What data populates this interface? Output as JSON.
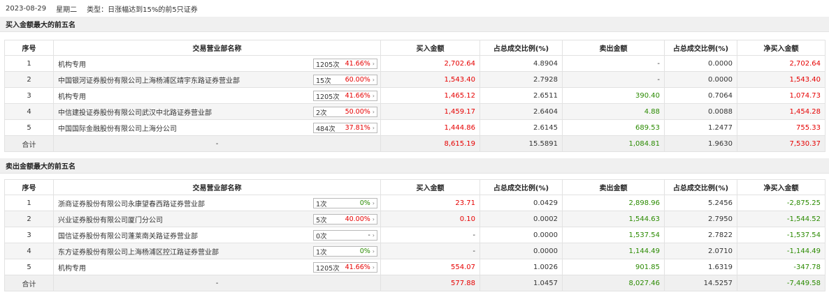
{
  "header": {
    "date": "2023-08-29",
    "weekday": "星期二",
    "type_label": "类型：日涨幅达到15%的前5只证券"
  },
  "buy": {
    "title": "买入金额最大的前五名",
    "columns": [
      "序号",
      "交易营业部名称",
      "买入金额",
      "占总成交比例(%)",
      "卖出金额",
      "占总成交比例(%)",
      "净买入金额"
    ],
    "rows": [
      {
        "no": "1",
        "name": "机构专用",
        "count": "1205次",
        "pct": "41.66%",
        "buy": "2,702.64",
        "buy_ratio": "4.8904",
        "sell": "-",
        "sell_ratio": "0.0000",
        "net": "2,702.64"
      },
      {
        "no": "2",
        "name": "中国银河证券股份有限公司上海杨浦区靖宇东路证券营业部",
        "count": "15次",
        "pct": "60.00%",
        "buy": "1,543.40",
        "buy_ratio": "2.7928",
        "sell": "-",
        "sell_ratio": "0.0000",
        "net": "1,543.40"
      },
      {
        "no": "3",
        "name": "机构专用",
        "count": "1205次",
        "pct": "41.66%",
        "buy": "1,465.12",
        "buy_ratio": "2.6511",
        "sell": "390.40",
        "sell_ratio": "0.7064",
        "net": "1,074.73"
      },
      {
        "no": "4",
        "name": "中信建投证券股份有限公司武汉中北路证券营业部",
        "count": "2次",
        "pct": "50.00%",
        "buy": "1,459.17",
        "buy_ratio": "2.6404",
        "sell": "4.88",
        "sell_ratio": "0.0088",
        "net": "1,454.28"
      },
      {
        "no": "5",
        "name": "中国国际金融股份有限公司上海分公司",
        "count": "484次",
        "pct": "37.81%",
        "buy": "1,444.86",
        "buy_ratio": "2.6145",
        "sell": "689.53",
        "sell_ratio": "1.2477",
        "net": "755.33"
      }
    ],
    "total": {
      "label": "合计",
      "name": "-",
      "buy": "8,615.19",
      "buy_ratio": "15.5891",
      "sell": "1,084.81",
      "sell_ratio": "1.9630",
      "net": "7,530.37"
    }
  },
  "sell": {
    "title": "卖出金额最大的前五名",
    "columns": [
      "序号",
      "交易营业部名称",
      "买入金额",
      "占总成交比例(%)",
      "卖出金额",
      "占总成交比例(%)",
      "净买入金额"
    ],
    "rows": [
      {
        "no": "1",
        "name": "浙商证券股份有限公司永康望春西路证券营业部",
        "count": "1次",
        "pct": "0%",
        "buy": "23.71",
        "buy_ratio": "0.0429",
        "sell": "2,898.96",
        "sell_ratio": "5.2456",
        "net": "-2,875.25"
      },
      {
        "no": "2",
        "name": "兴业证券股份有限公司厦门分公司",
        "count": "5次",
        "pct": "40.00%",
        "buy": "0.10",
        "buy_ratio": "0.0002",
        "sell": "1,544.63",
        "sell_ratio": "2.7950",
        "net": "-1,544.52"
      },
      {
        "no": "3",
        "name": "国信证券股份有限公司蓬莱南关路证券营业部",
        "count": "0次",
        "pct": "-",
        "buy": "-",
        "buy_ratio": "0.0000",
        "sell": "1,537.54",
        "sell_ratio": "2.7822",
        "net": "-1,537.54"
      },
      {
        "no": "4",
        "name": "东方证券股份有限公司上海杨浦区控江路证券营业部",
        "count": "1次",
        "pct": "0%",
        "buy": "-",
        "buy_ratio": "0.0000",
        "sell": "1,144.49",
        "sell_ratio": "2.0710",
        "net": "-1,144.49"
      },
      {
        "no": "5",
        "name": "机构专用",
        "count": "1205次",
        "pct": "41.66%",
        "buy": "554.07",
        "buy_ratio": "1.0026",
        "sell": "901.85",
        "sell_ratio": "1.6319",
        "net": "-347.78"
      }
    ],
    "total": {
      "label": "合计",
      "name": "-",
      "buy": "577.88",
      "buy_ratio": "1.0457",
      "sell": "8,027.46",
      "sell_ratio": "14.5257",
      "net": "-7,449.58"
    }
  },
  "arrow_glyph": "›"
}
